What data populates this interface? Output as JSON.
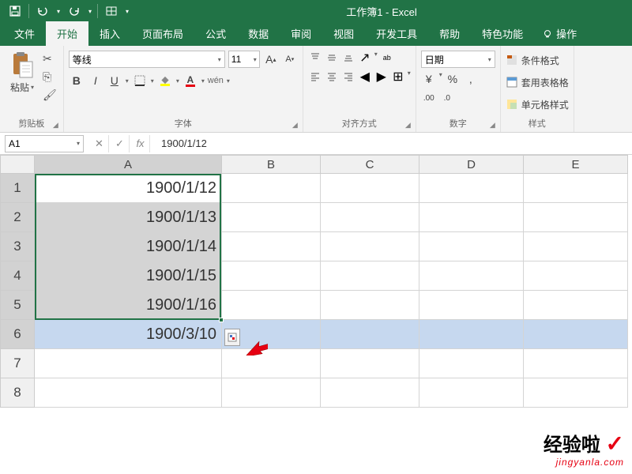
{
  "title": {
    "document": "工作簿1",
    "separator": " - ",
    "app": "Excel"
  },
  "tabs": {
    "file": "文件",
    "home": "开始",
    "insert": "插入",
    "layout": "页面布局",
    "formulas": "公式",
    "data": "数据",
    "review": "审阅",
    "view": "视图",
    "developer": "开发工具",
    "help": "帮助",
    "special": "特色功能",
    "tellme": "操作"
  },
  "clipboard": {
    "paste": "粘贴",
    "label": "剪贴板"
  },
  "font": {
    "name": "等线",
    "size": "11",
    "label": "字体",
    "bold": "B",
    "italic": "I",
    "underline": "U",
    "phonetic": "wén"
  },
  "alignment": {
    "label": "对齐方式",
    "wrap": "ab"
  },
  "number": {
    "format": "日期",
    "label": "数字",
    "percent": "%",
    "comma": ",",
    "currency": "¥"
  },
  "styles": {
    "conditional": "条件格式",
    "table": "套用表格格",
    "cell": "单元格样式",
    "label": "样式"
  },
  "namebox": "A1",
  "formula": "1900/1/12",
  "columns": [
    "A",
    "B",
    "C",
    "D",
    "E"
  ],
  "rows": [
    "1",
    "2",
    "3",
    "4",
    "5",
    "6",
    "7",
    "8"
  ],
  "cells": {
    "A1": "1900/1/12",
    "A2": "1900/1/13",
    "A3": "1900/1/14",
    "A4": "1900/1/15",
    "A5": "1900/1/16",
    "A6": "1900/3/10"
  },
  "chart_data": null,
  "watermark": {
    "text1": "经验啦",
    "check": "✓",
    "url": "jingyanla.com"
  }
}
